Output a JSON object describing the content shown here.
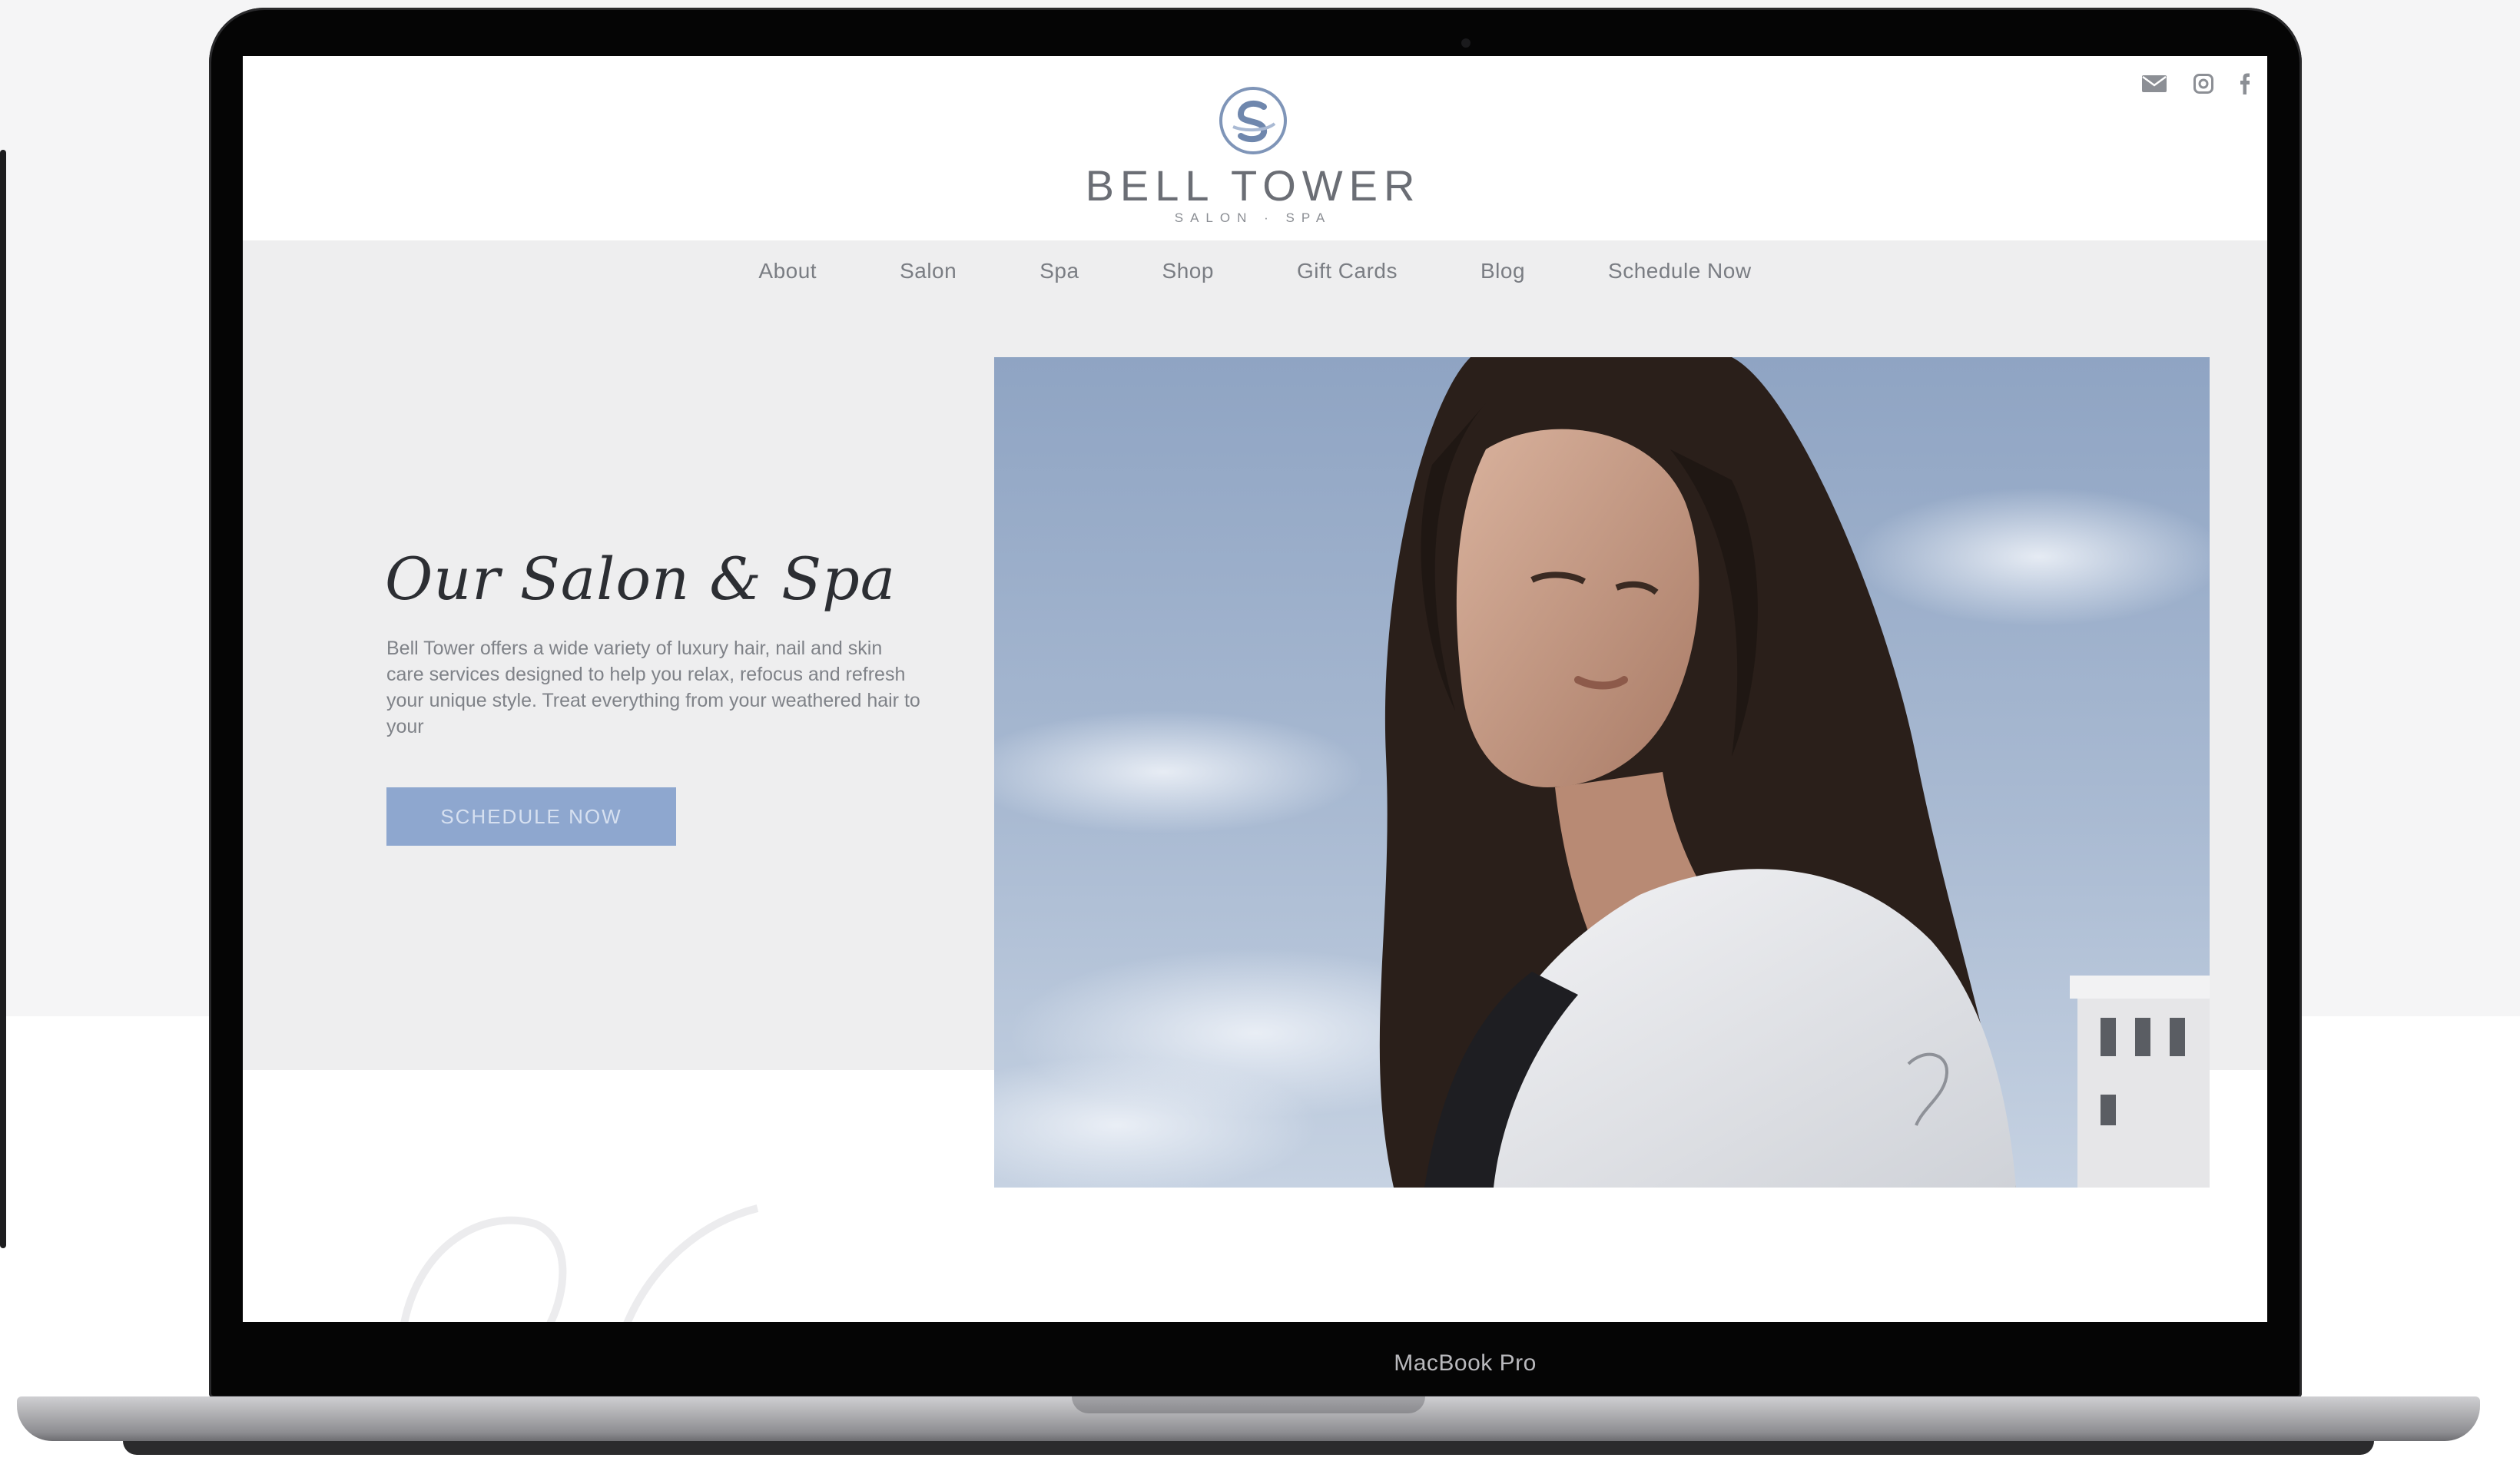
{
  "device": {
    "label": "MacBook Pro"
  },
  "site": {
    "brand": {
      "name": "BELL TOWER",
      "subtitle": "SALON · SPA"
    },
    "social_icons": [
      "email-icon",
      "instagram-icon",
      "facebook-icon"
    ],
    "nav": {
      "items": [
        "About",
        "Salon",
        "Spa",
        "Shop",
        "Gift Cards",
        "Blog",
        "Schedule Now"
      ]
    },
    "hero": {
      "heading": "Our Salon & Spa",
      "description": "Bell Tower offers a wide variety of luxury hair, nail and skin care services designed to help you relax, refocus and refresh your unique style. Treat everything from your weathered hair to your",
      "cta_label": "SCHEDULE NOW"
    }
  },
  "colors": {
    "accent": "#8ea7cf",
    "nav_bg": "#eeeeef",
    "text_muted": "#7a7d83"
  }
}
